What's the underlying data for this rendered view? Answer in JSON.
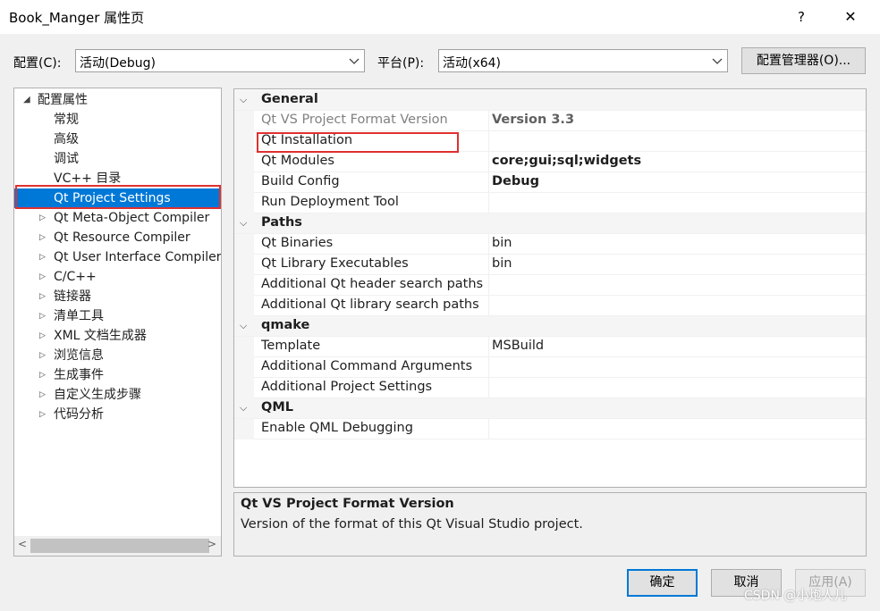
{
  "window": {
    "title": "Book_Manger 属性页",
    "help": "?",
    "close": "✕"
  },
  "config_row": {
    "config_label": "配置(C):",
    "config_value": "活动(Debug)",
    "platform_label": "平台(P):",
    "platform_value": "活动(x64)",
    "manager_button": "配置管理器(O)..."
  },
  "tree": {
    "root": "配置属性",
    "items": [
      {
        "label": "常规",
        "expandable": false
      },
      {
        "label": "高级",
        "expandable": false
      },
      {
        "label": "调试",
        "expandable": false
      },
      {
        "label": "VC++ 目录",
        "expandable": false
      },
      {
        "label": "Qt Project Settings",
        "expandable": false,
        "selected": true
      },
      {
        "label": "Qt Meta-Object Compiler",
        "expandable": true
      },
      {
        "label": "Qt Resource Compiler",
        "expandable": true
      },
      {
        "label": "Qt User Interface Compiler",
        "expandable": true
      },
      {
        "label": "C/C++",
        "expandable": true
      },
      {
        "label": "链接器",
        "expandable": true
      },
      {
        "label": "清单工具",
        "expandable": true
      },
      {
        "label": "XML 文档生成器",
        "expandable": true
      },
      {
        "label": "浏览信息",
        "expandable": true
      },
      {
        "label": "生成事件",
        "expandable": true
      },
      {
        "label": "自定义生成步骤",
        "expandable": true
      },
      {
        "label": "代码分析",
        "expandable": true
      }
    ]
  },
  "grid": {
    "rows": [
      {
        "type": "category",
        "name": "General"
      },
      {
        "type": "prop",
        "name": "Qt VS Project Format Version",
        "value": "Version 3.3",
        "readonly": true
      },
      {
        "type": "prop",
        "name": "Qt Installation",
        "value": ""
      },
      {
        "type": "prop",
        "name": "Qt Modules",
        "value": "core;gui;sql;widgets",
        "bold": true
      },
      {
        "type": "prop",
        "name": "Build Config",
        "value": "Debug",
        "bold": true
      },
      {
        "type": "prop",
        "name": "Run Deployment Tool",
        "value": ""
      },
      {
        "type": "category",
        "name": "Paths"
      },
      {
        "type": "prop",
        "name": "Qt Binaries",
        "value": "bin"
      },
      {
        "type": "prop",
        "name": "Qt Library Executables",
        "value": "bin"
      },
      {
        "type": "prop",
        "name": "Additional Qt header search paths",
        "value": ""
      },
      {
        "type": "prop",
        "name": "Additional Qt library search paths",
        "value": ""
      },
      {
        "type": "category",
        "name": "qmake"
      },
      {
        "type": "prop",
        "name": "Template",
        "value": "MSBuild"
      },
      {
        "type": "prop",
        "name": "Additional Command Arguments",
        "value": ""
      },
      {
        "type": "prop",
        "name": "Additional Project Settings",
        "value": ""
      },
      {
        "type": "category",
        "name": "QML"
      },
      {
        "type": "prop",
        "name": "Enable QML Debugging",
        "value": ""
      }
    ]
  },
  "description": {
    "title": "Qt VS Project Format Version",
    "text": "Version of the format of this Qt Visual Studio project."
  },
  "buttons": {
    "ok": "确定",
    "cancel": "取消",
    "apply": "应用(A)"
  },
  "watermark": "CSDN @小炮人儿",
  "colors": {
    "selection": "#0078d7",
    "highlight_box": "#e03030"
  }
}
